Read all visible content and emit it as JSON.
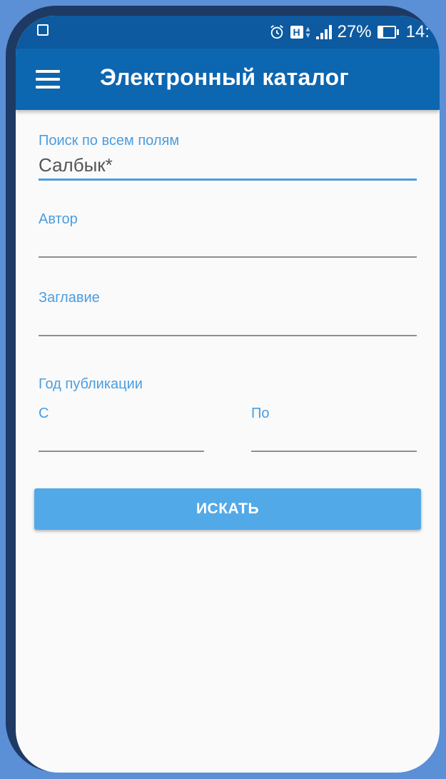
{
  "status_bar": {
    "battery": "27%",
    "time": "14:"
  },
  "app_bar": {
    "title": "Электронный каталог",
    "menu_icon": "hamburger-menu-icon"
  },
  "form": {
    "all_fields": {
      "label": "Поиск по всем полям",
      "value": "Салбык*"
    },
    "author": {
      "label": "Автор",
      "value": ""
    },
    "title": {
      "label": "Заглавие",
      "value": ""
    },
    "year": {
      "section_label": "Год публикации",
      "from_label": "С",
      "from_value": "",
      "to_label": "По",
      "to_value": ""
    },
    "search_button": "ИСКАТЬ"
  },
  "colors": {
    "app_bar": "#0d66b0",
    "status_bar": "#0d5aa0",
    "accent": "#4a9de0",
    "button": "#52a9e8",
    "background": "#fafafa"
  }
}
